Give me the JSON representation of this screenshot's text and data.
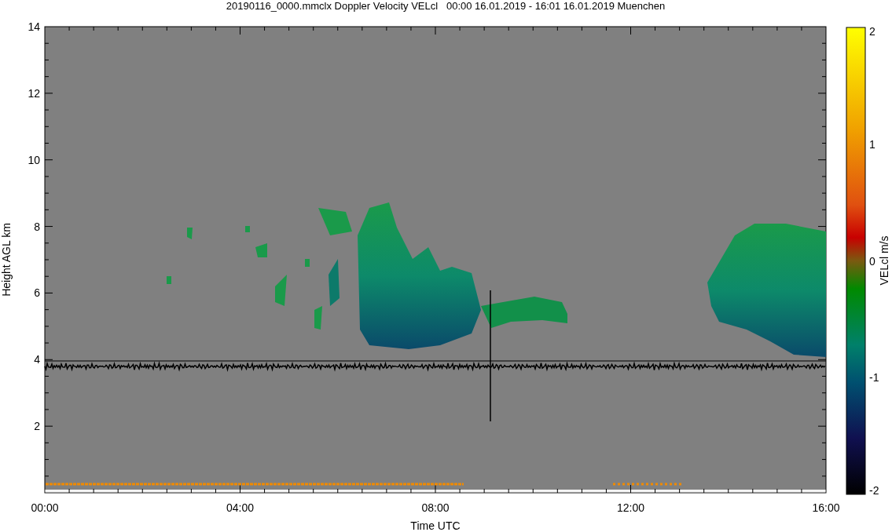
{
  "title": "20190116_0000.mmclx Doppler Velocity VELcl   00:00 16.01.2019 - 16:01 16.01.2019 Muenchen",
  "plot": {
    "ylabel": "Height AGL km",
    "xlabel": "Time UTC",
    "yticks": [
      "14",
      "12",
      "10",
      "8",
      "6",
      "4",
      "2"
    ],
    "xticks": [
      "00:00",
      "04:00",
      "08:00",
      "12:00",
      "16:00"
    ]
  },
  "colorbar": {
    "label": "VELcl m/s",
    "ticks": [
      "2",
      "1",
      "0",
      "-1",
      "-2"
    ]
  }
}
